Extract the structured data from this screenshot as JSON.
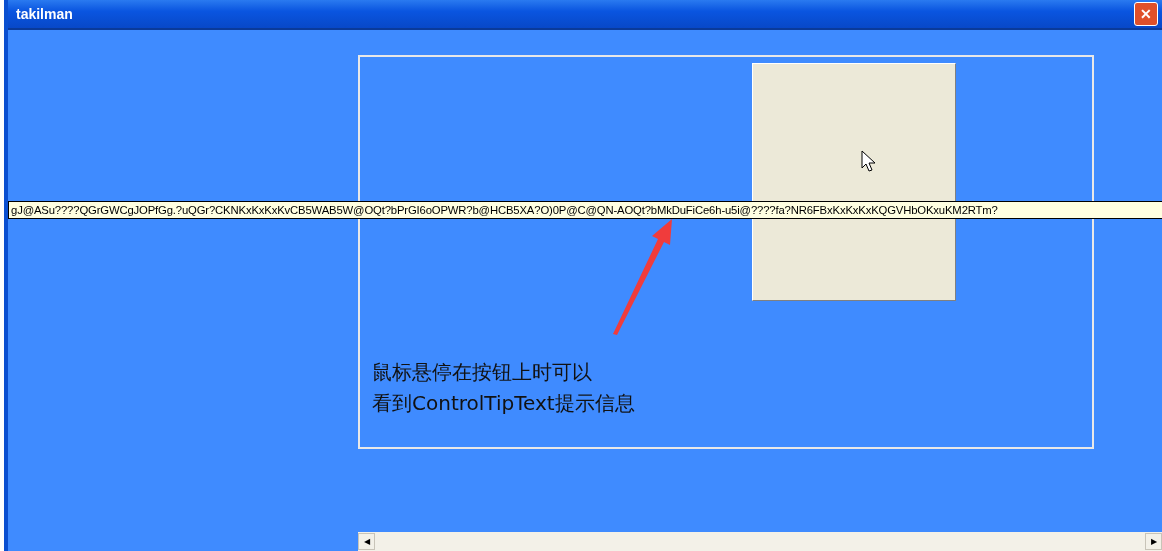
{
  "window": {
    "title": "takilman",
    "close": "✕"
  },
  "tooltip": {
    "text": "gJ@ASu????QGrGWCgJOPfGg.?uQGr?CKNKxKxKxKvCB5WAB5W@OQt?bPrGI6oOPWR?b@HCB5XA?O)0P@C@QN-AOQt?bMkDuFiCe6h-u5i@????fa?NR6FBxKxKxKxKQGVHbOKxuKM2RTm?"
  },
  "caption": [
    "鼠标悬停在按钮上时可以",
    "看到ControlTipText提示信息"
  ],
  "scrollbar": {
    "left": "◀",
    "right": "▶"
  }
}
